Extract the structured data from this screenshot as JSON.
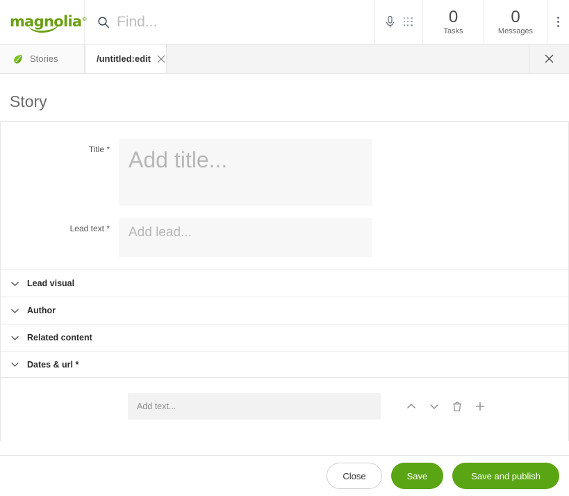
{
  "header": {
    "logo_text": "magnolia",
    "logo_registered": "®",
    "logo_color": "#6aa012",
    "search": {
      "placeholder": "Find...",
      "value": "",
      "icon": "search-icon"
    },
    "mic_icon": "microphone-icon",
    "apps_icon": "apps-grid-icon",
    "counters": [
      {
        "count": "0",
        "label": "Tasks"
      },
      {
        "count": "0",
        "label": "Messages"
      }
    ],
    "overflow_icon": "vertical-dots-icon"
  },
  "tabbar": {
    "tabs": [
      {
        "label": "Stories",
        "icon": "leaf-icon",
        "active": false
      },
      {
        "label": "/untitled:edit",
        "icon": "close-icon",
        "active": true
      }
    ],
    "close_all_icon": "close-icon"
  },
  "page": {
    "title": "Story"
  },
  "form": {
    "fields": [
      {
        "label": "Title *",
        "placeholder": "Add title...",
        "value": "",
        "name": "title-field"
      },
      {
        "label": "Lead text *",
        "placeholder": "Add lead...",
        "value": "",
        "name": "lead-text-field"
      }
    ],
    "sections": [
      {
        "label": "Lead visual",
        "icon": "chevron-down-icon"
      },
      {
        "label": "Author",
        "icon": "chevron-down-icon"
      },
      {
        "label": "Related content",
        "icon": "chevron-down-icon"
      },
      {
        "label": "Dates & url *",
        "icon": "chevron-down-icon"
      }
    ],
    "block": {
      "placeholder": "Add text...",
      "value": "",
      "actions": [
        {
          "name": "move-up-icon",
          "title": "Move up"
        },
        {
          "name": "move-down-icon",
          "title": "Move down"
        },
        {
          "name": "trash-icon",
          "title": "Delete"
        },
        {
          "name": "add-icon",
          "title": "Add"
        }
      ]
    }
  },
  "footer": {
    "close_label": "Close",
    "save_label": "Save",
    "publish_label": "Save and publish",
    "accent_color": "#5aa513"
  }
}
